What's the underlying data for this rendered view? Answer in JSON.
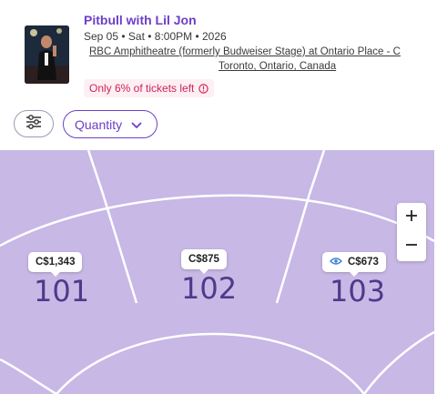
{
  "event": {
    "title": "Pitbull with Lil Jon",
    "date_line": "Sep 05 • Sat • 8:00PM • 2026",
    "venue": "RBC Amphitheatre (formerly Budweiser Stage) at Ontario Place - C",
    "city": "Toronto, Ontario, Canada",
    "alert": "Only 6% of tickets left"
  },
  "controls": {
    "quantity_label": "Quantity",
    "zoom_in": "+",
    "zoom_out": "−"
  },
  "sections": [
    {
      "number": "101",
      "price": "C$1,343"
    },
    {
      "number": "102",
      "price": "C$875"
    },
    {
      "number": "103",
      "price": "C$673"
    }
  ],
  "colors": {
    "brand": "#6d3ec8",
    "alert": "#d0245a",
    "map_section": "#c7b8e6",
    "section_number": "#4c3a8a"
  },
  "icons": [
    "filter-icon",
    "chevron-down-icon",
    "info-icon",
    "eye-icon",
    "plus-icon",
    "minus-icon"
  ]
}
